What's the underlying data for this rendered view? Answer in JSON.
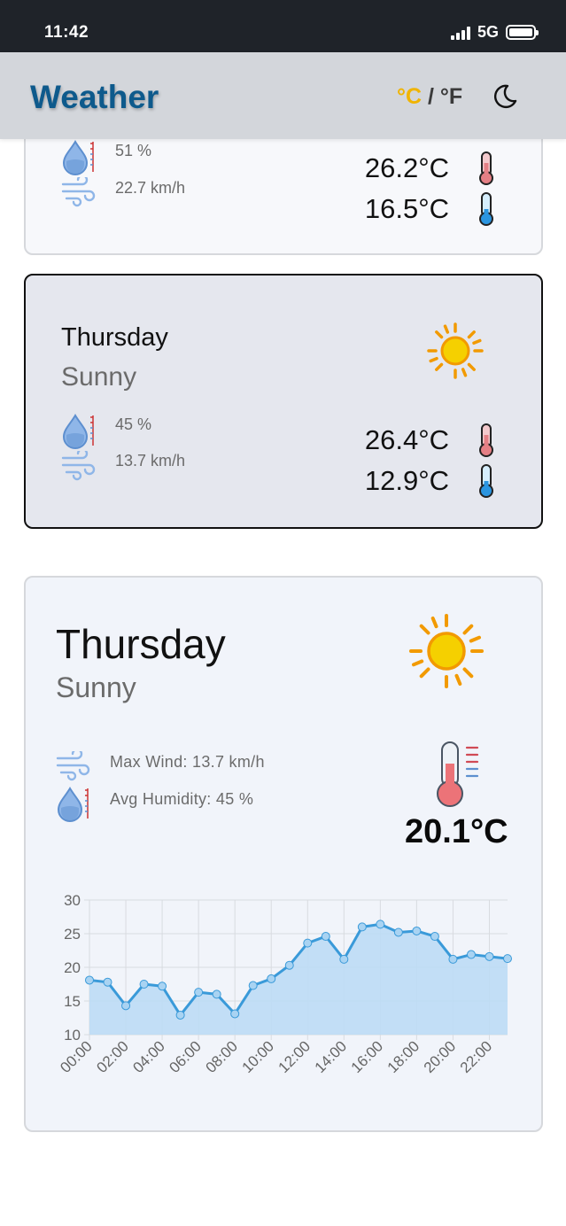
{
  "status": {
    "time": "11:42",
    "network": "5G"
  },
  "header": {
    "title": "Weather",
    "unit_c": "°C",
    "unit_sep": " / ",
    "unit_f": "°F",
    "moon_icon": "moon-icon"
  },
  "forecast_cards": [
    {
      "humidity": "51 %",
      "wind": "22.7 km/h",
      "temp_max": "26.2°C",
      "temp_min": "16.5°C"
    },
    {
      "day": "Thursday",
      "condition": "Sunny",
      "humidity": "45 %",
      "wind": "13.7 km/h",
      "temp_max": "26.4°C",
      "temp_min": "12.9°C",
      "selected": true
    }
  ],
  "detail": {
    "day": "Thursday",
    "condition": "Sunny",
    "max_wind": "Max Wind: 13.7 km/h",
    "avg_humidity": "Avg Humidity: 45 %",
    "current_temp": "20.1°C"
  },
  "colors": {
    "accent": "#0e5a8c",
    "unit_active": "#f0b400",
    "series_line": "#3a9ad9",
    "series_fill": "#bcdcf5",
    "sun": "#f5c400",
    "sun_rays": "#f29a00"
  },
  "chart_data": {
    "type": "area",
    "x": [
      "00:00",
      "01:00",
      "02:00",
      "03:00",
      "04:00",
      "05:00",
      "06:00",
      "07:00",
      "08:00",
      "09:00",
      "10:00",
      "11:00",
      "12:00",
      "13:00",
      "14:00",
      "15:00",
      "16:00",
      "17:00",
      "18:00",
      "19:00",
      "20:00",
      "21:00",
      "22:00",
      "23:00"
    ],
    "x_tick_labels": [
      "00:00",
      "02:00",
      "04:00",
      "06:00",
      "08:00",
      "10:00",
      "12:00",
      "14:00",
      "16:00",
      "18:00",
      "20:00",
      "22:00"
    ],
    "series": [
      {
        "values": [
          18.1,
          17.8,
          14.3,
          17.5,
          17.2,
          12.9,
          16.3,
          16.0,
          13.1,
          17.3,
          18.3,
          20.3,
          23.6,
          24.6,
          21.2,
          26.0,
          26.4,
          25.2,
          25.4,
          24.6,
          21.2,
          21.9,
          21.6,
          21.3
        ]
      }
    ],
    "y_ticks": [
      10,
      15,
      20,
      25,
      30
    ],
    "ylim": [
      10,
      30
    ],
    "title": "",
    "xlabel": "",
    "ylabel": "",
    "grid": true
  }
}
